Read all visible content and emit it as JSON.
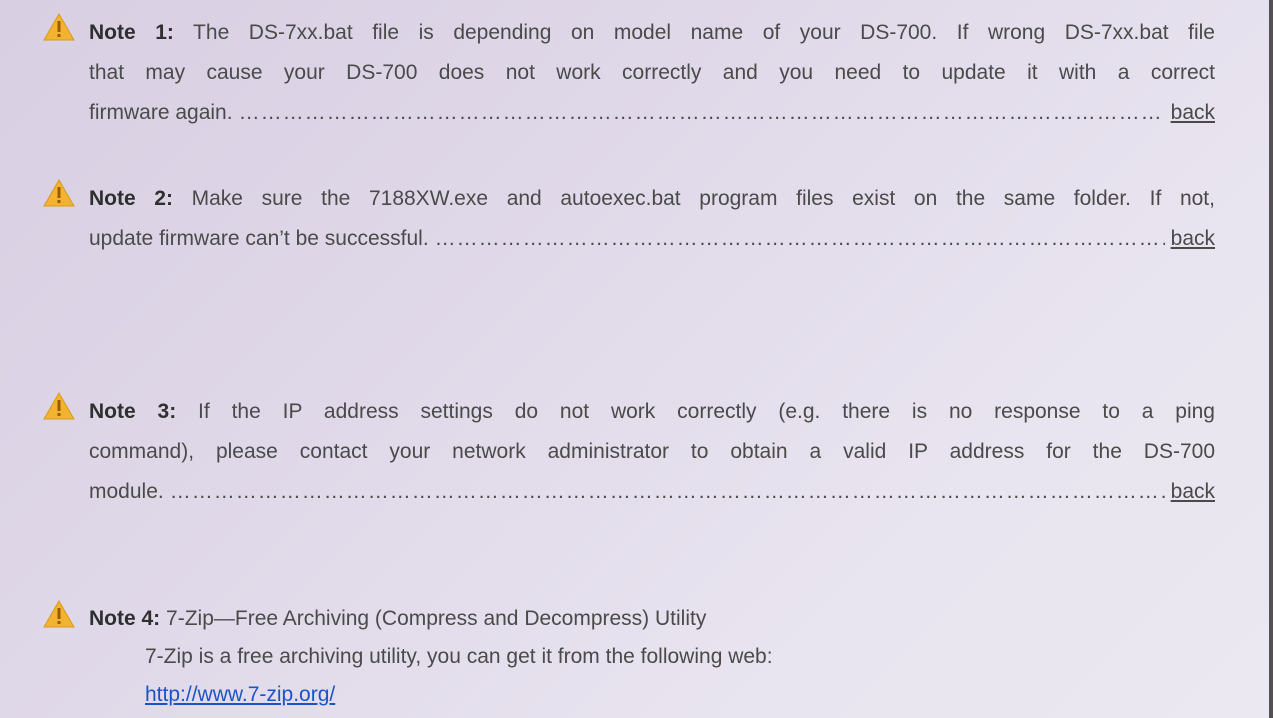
{
  "notes": [
    {
      "label": "Note 1:",
      "text1": " The DS-7xx.bat file is depending on model name of your DS-700. If wrong DS-7xx.bat file",
      "text2": "that may cause your DS-700 does not work correctly and you need to update it with a correct",
      "text3": "firmware again.",
      "link": "back"
    },
    {
      "label": "Note 2:",
      "text1": " Make sure the 7188XW.exe and autoexec.bat program files exist on the same folder. If not,",
      "text2": "update firmware can’t be successful.",
      "link": "back"
    },
    {
      "label": "Note 3:",
      "text1": " If the IP address settings do not work correctly (e.g. there is no response to a ping",
      "text2": "command), please contact your network administrator to obtain a valid IP address for the DS-700",
      "text3": "module.",
      "link": "back"
    },
    {
      "label": "Note 4:",
      "text1": " 7-Zip—Free Archiving (Compress and Decompress) Utility",
      "text2": "7-Zip is a free archiving utility, you can get it from the following web:",
      "url": "http://www.7-zip.org/"
    }
  ],
  "leader": "………………………………………………………………………………………………………………………………………………………………………………………………………………",
  "icon": "warning-triangle-icon",
  "colors": {
    "icon_fill": "#f2b430",
    "icon_mark": "#9a5a00",
    "link": "#1a55c7",
    "text": "#4a4a4a"
  }
}
